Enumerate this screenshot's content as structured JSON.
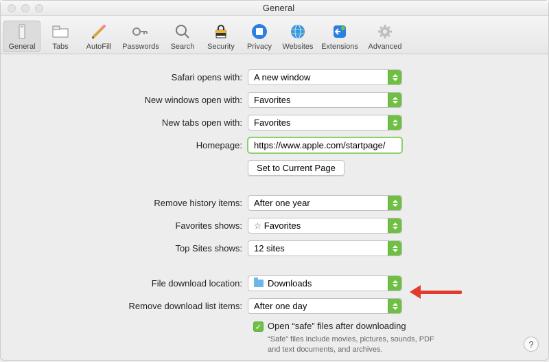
{
  "window": {
    "title": "General"
  },
  "toolbar": {
    "items": [
      {
        "id": "general",
        "label": "General"
      },
      {
        "id": "tabs",
        "label": "Tabs"
      },
      {
        "id": "autofill",
        "label": "AutoFill"
      },
      {
        "id": "passwords",
        "label": "Passwords"
      },
      {
        "id": "search",
        "label": "Search"
      },
      {
        "id": "security",
        "label": "Security"
      },
      {
        "id": "privacy",
        "label": "Privacy"
      },
      {
        "id": "websites",
        "label": "Websites"
      },
      {
        "id": "extensions",
        "label": "Extensions"
      },
      {
        "id": "advanced",
        "label": "Advanced"
      }
    ]
  },
  "form": {
    "opens_with": {
      "label": "Safari opens with:",
      "value": "A new window"
    },
    "new_windows": {
      "label": "New windows open with:",
      "value": "Favorites"
    },
    "new_tabs": {
      "label": "New tabs open with:",
      "value": "Favorites"
    },
    "homepage": {
      "label": "Homepage:",
      "value": "https://www.apple.com/startpage/",
      "set_button": "Set to Current Page"
    },
    "remove_history": {
      "label": "Remove history items:",
      "value": "After one year"
    },
    "favorites_shows": {
      "label": "Favorites shows:",
      "value": "Favorites"
    },
    "topsites_shows": {
      "label": "Top Sites shows:",
      "value": "12 sites"
    },
    "download_location": {
      "label": "File download location:",
      "value": "Downloads"
    },
    "remove_downloads": {
      "label": "Remove download list items:",
      "value": "After one day"
    },
    "safe_files": {
      "checked": true,
      "label": "Open “safe” files after downloading",
      "description": "“Safe” files include movies, pictures, sounds, PDF and text documents, and archives."
    }
  },
  "help_button": "?"
}
